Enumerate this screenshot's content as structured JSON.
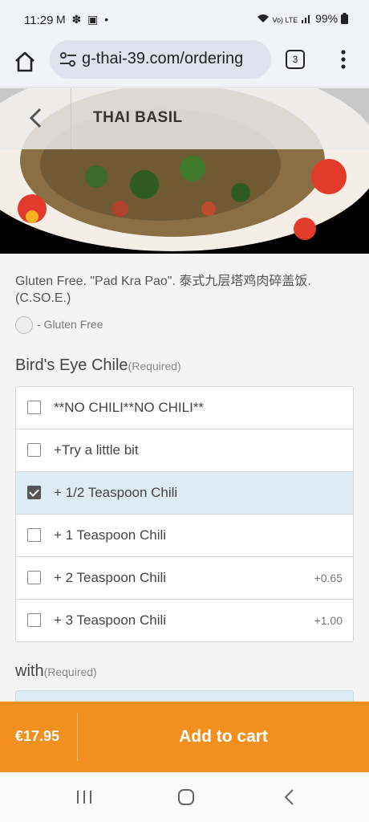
{
  "status": {
    "time": "11:29",
    "left_icons": "M ✽ ▣ •",
    "network": "Vo) LTE",
    "battery": "99%"
  },
  "browser": {
    "url": "g-thai-39.com/ordering",
    "tab_count": "3"
  },
  "hero": {
    "title": "THAI BASIL"
  },
  "item": {
    "description": "Gluten Free. \"Pad Kra Pao\". 泰式九层塔鸡肉碎盖饭. (C.SO.E.)",
    "tag": "- Gluten Free"
  },
  "groups": [
    {
      "title": "Bird's Eye Chile",
      "required": "(Required)",
      "options": [
        {
          "label": "**NO CHILI**NO CHILI**",
          "price": "",
          "selected": false
        },
        {
          "label": "+Try a little bit",
          "price": "",
          "selected": false
        },
        {
          "label": "+ 1/2 Teaspoon Chili",
          "price": "",
          "selected": true
        },
        {
          "label": "+ 1 Teaspoon Chili",
          "price": "",
          "selected": false
        },
        {
          "label": "+ 2 Teaspoon Chili",
          "price": "+0.65",
          "selected": false
        },
        {
          "label": "+ 3 Teaspoon Chili",
          "price": "+1.00",
          "selected": false
        }
      ]
    },
    {
      "title": "with",
      "required": "(Required)"
    }
  ],
  "cart": {
    "price": "€17.95",
    "button": "Add to cart"
  },
  "colors": {
    "accent": "#f18f1f",
    "selected_row": "#ddebf3"
  }
}
